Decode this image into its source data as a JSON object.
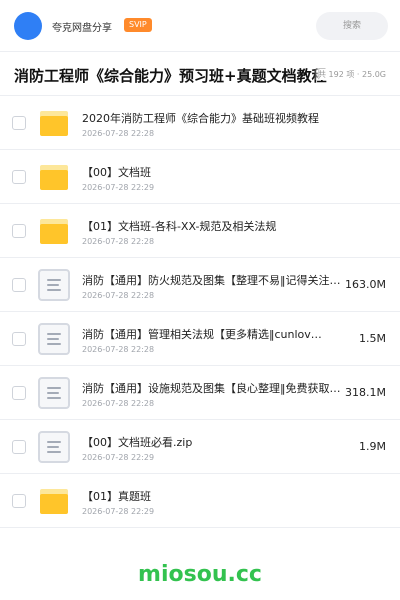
{
  "header": {
    "username": "夸克网盘分享",
    "badge": "SVIP",
    "search_label": "搜索"
  },
  "title_bar": {
    "title": "消防工程师《综合能力》预习班+真题文档教程",
    "meta": "共 192 项 · 25.0G"
  },
  "files": [
    {
      "type": "folder",
      "name": "2020年消防工程师《综合能力》基础班视频教程",
      "date": "2026-07-28 22:28",
      "size": ""
    },
    {
      "type": "folder",
      "name": "【00】文档班",
      "date": "2026-07-28 22:29",
      "size": ""
    },
    {
      "type": "folder",
      "name": "【01】文档班-各科-XX-规范及相关法规",
      "date": "2026-07-28 22:28",
      "size": ""
    },
    {
      "type": "file",
      "name": "消防【通用】防火规范及图集【整理不易‖记得关注：C",
      "date": "2026-07-28 22:28",
      "size": "163.0M"
    },
    {
      "type": "file",
      "name": "消防【通用】管理相关法规【更多精选‖cunlov…",
      "date": "2026-07-28 22:28",
      "size": "1.5M"
    },
    {
      "type": "file",
      "name": "消防【通用】设施规范及图集【良心整理‖免费获取：c",
      "date": "2026-07-28 22:28",
      "size": "318.1M"
    },
    {
      "type": "file",
      "name": "【00】文档班必看.zip",
      "date": "2026-07-28 22:29",
      "size": "1.9M"
    },
    {
      "type": "folder",
      "name": "【01】真题班",
      "date": "2026-07-28 22:29",
      "size": ""
    }
  ],
  "watermark": "miosou.cc"
}
